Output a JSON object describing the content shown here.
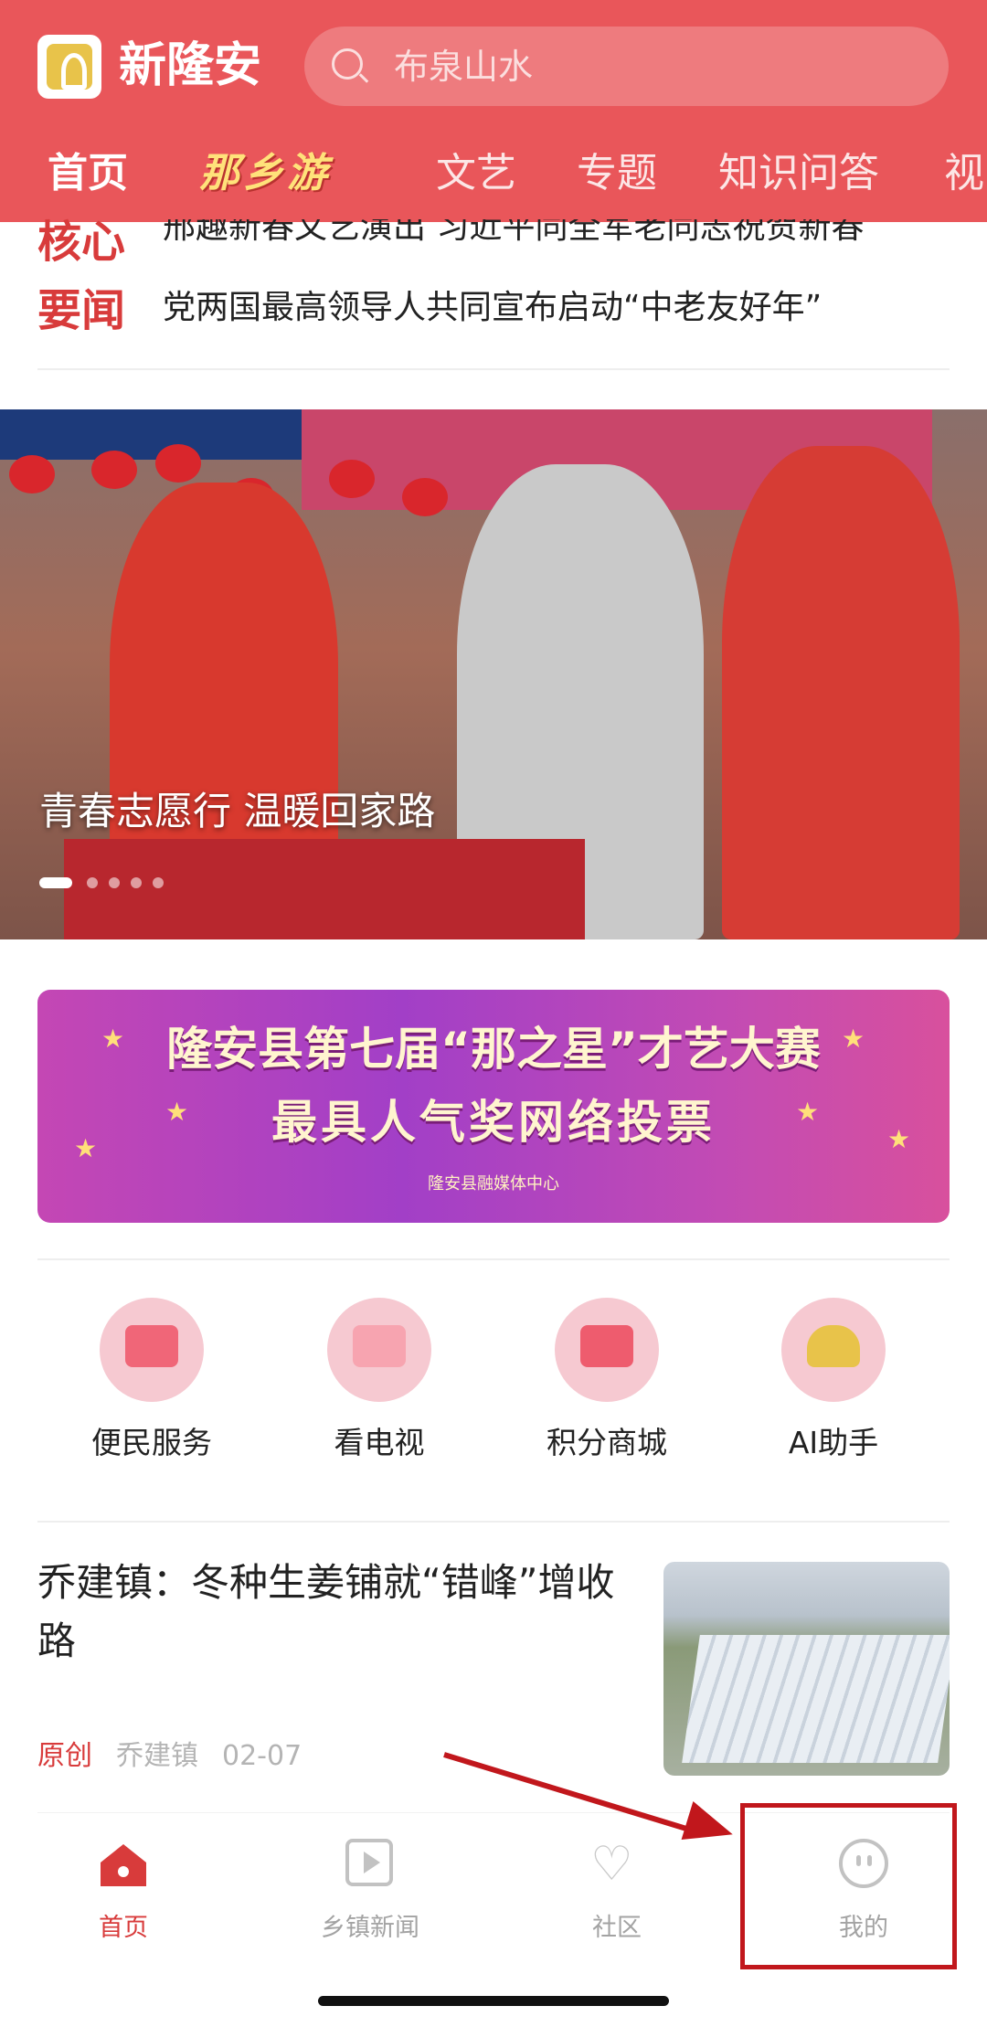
{
  "header": {
    "app_title": "新隆安",
    "search_placeholder": "布泉山水",
    "tabs": [
      {
        "label": "首页"
      },
      {
        "label": "那乡游"
      },
      {
        "label": "文艺"
      },
      {
        "label": "专题"
      },
      {
        "label": "知识问答"
      },
      {
        "label": "视"
      }
    ],
    "accent_color": "#e9565a"
  },
  "headline_ticker": {
    "label_line1": "核心",
    "label_line2": "要闻",
    "items": [
      "邢趣新春文艺演出 习近平同全军老同志祝贺新春",
      "党两国最高领导人共同宣布启动“中老友好年”"
    ]
  },
  "carousel": {
    "caption": "青春志愿行  温暖回家路",
    "slide_count": 5,
    "active_index": 0
  },
  "promo_banner": {
    "line1": "隆安县第七届“那之星”才艺大赛",
    "line2": "最具人气奖网络投票",
    "credit": "隆安县融媒体中心"
  },
  "services": [
    {
      "label": "便民服务",
      "icon": "service-icon"
    },
    {
      "label": "看电视",
      "icon": "tv-icon"
    },
    {
      "label": "积分商城",
      "icon": "shop-icon"
    },
    {
      "label": "AI助手",
      "icon": "ai-assistant-icon"
    }
  ],
  "article": {
    "title": "乔建镇：冬种生姜铺就“错峰”增收路",
    "tag": "原创",
    "source": "乔建镇",
    "date": "02-07"
  },
  "bottom_nav": [
    {
      "label": "首页",
      "icon": "home-icon",
      "active": true
    },
    {
      "label": "乡镇新闻",
      "icon": "play-icon",
      "active": false
    },
    {
      "label": "社区",
      "icon": "heart-icon",
      "active": false
    },
    {
      "label": "我的",
      "icon": "profile-face-icon",
      "active": false
    }
  ],
  "annotation": {
    "highlight_color": "#c1171c",
    "target": "我的"
  }
}
